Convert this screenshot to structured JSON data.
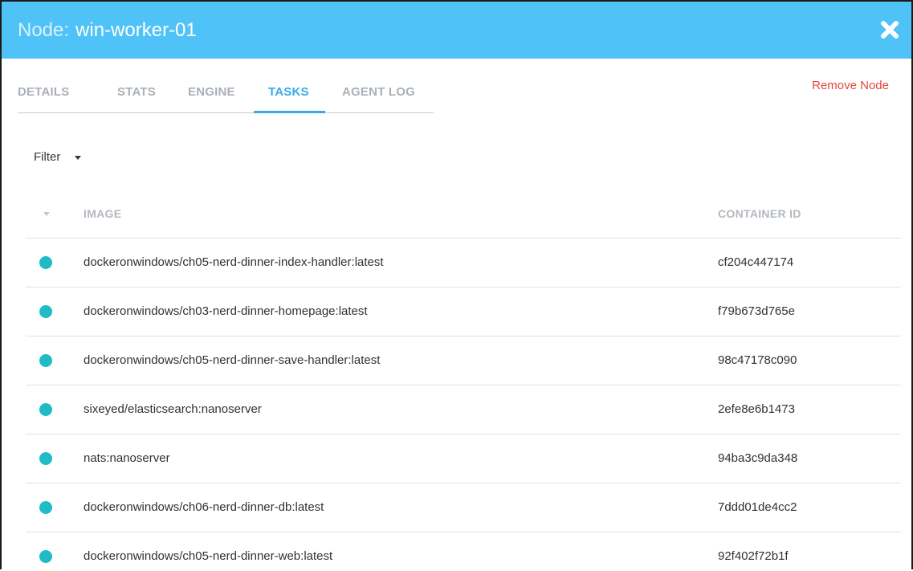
{
  "header": {
    "prefix": "Node:",
    "node_name": "win-worker-01",
    "close_icon": "close-icon",
    "background_color": "#4fc3f7"
  },
  "tabs": [
    {
      "label": "DETAILS",
      "active": false
    },
    {
      "label": "STATS",
      "active": false
    },
    {
      "label": "ENGINE",
      "active": false
    },
    {
      "label": "TASKS",
      "active": true
    },
    {
      "label": "AGENT LOG",
      "active": false
    }
  ],
  "actions": {
    "remove_node": "Remove Node"
  },
  "filter": {
    "label": "Filter"
  },
  "table": {
    "columns": [
      "IMAGE",
      "CONTAINER ID"
    ],
    "status_color": "#1fbcc6",
    "rows": [
      {
        "image": "dockeronwindows/ch05-nerd-dinner-index-handler:latest",
        "container_id": "cf204c447174"
      },
      {
        "image": "dockeronwindows/ch03-nerd-dinner-homepage:latest",
        "container_id": "f79b673d765e"
      },
      {
        "image": "dockeronwindows/ch05-nerd-dinner-save-handler:latest",
        "container_id": "98c47178c090"
      },
      {
        "image": "sixeyed/elasticsearch:nanoserver",
        "container_id": "2efe8e6b1473"
      },
      {
        "image": "nats:nanoserver",
        "container_id": "94ba3c9da348"
      },
      {
        "image": "dockeronwindows/ch06-nerd-dinner-db:latest",
        "container_id": "7ddd01de4cc2"
      },
      {
        "image": "dockeronwindows/ch05-nerd-dinner-web:latest",
        "container_id": "92f402f72b1f"
      }
    ]
  }
}
